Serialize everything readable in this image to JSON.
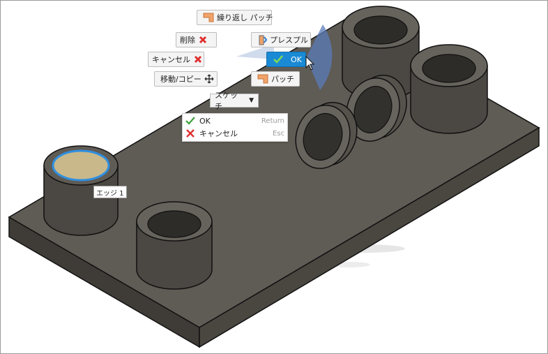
{
  "marking_menu": {
    "repeat_patch": "繰り返し パッチ",
    "delete": "削除",
    "press_pull": "プレスプル",
    "cancel": "キャンセル",
    "ok": "OK",
    "move_copy": "移動/コピー",
    "patch": "パッチ",
    "sketch_dropdown": "スケッチ"
  },
  "shortcuts": [
    {
      "label": "OK",
      "key": "Return"
    },
    {
      "label": "キャンセル",
      "key": "Esc"
    }
  ],
  "tooltip": {
    "text": "エッジ 1"
  },
  "colors": {
    "body_top": "#5f5b55",
    "body_side": "#3f3c37",
    "selected_face": "#c9b88a",
    "selection_outline": "#2f8fe0",
    "ok_button": "#1a8ad4"
  }
}
